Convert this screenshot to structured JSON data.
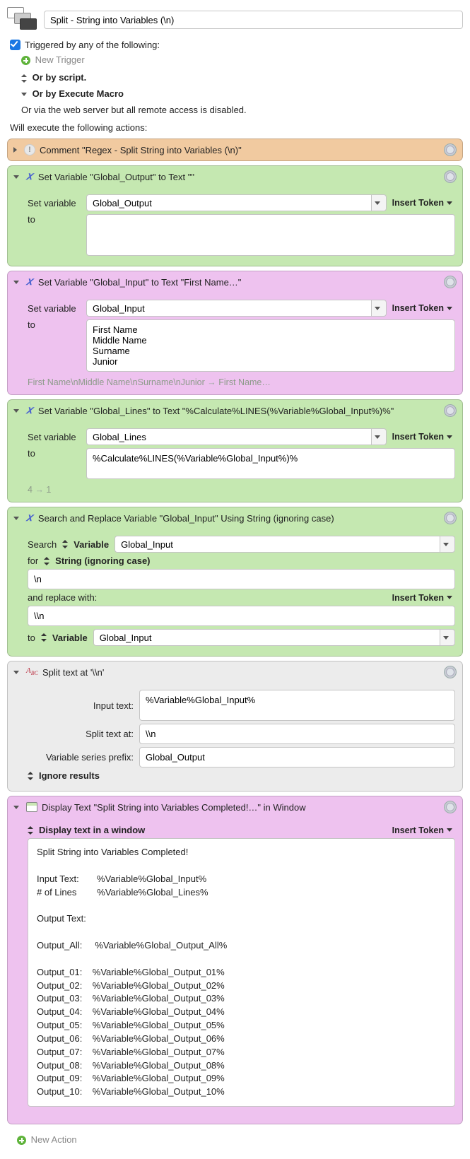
{
  "header": {
    "title": "Split - String into Variables (\\n)"
  },
  "trigger": {
    "checkbox_label": "Triggered by any of the following:",
    "new_trigger": "New Trigger",
    "by_script": "Or by script.",
    "by_execute_macro": "Or by Execute Macro",
    "via_web": "Or via the web server but all remote access is disabled."
  },
  "will_execute": "Will execute the following actions:",
  "labels": {
    "set_variable": "Set variable",
    "to": "to",
    "insert_token": "Insert Token",
    "search": "Search",
    "variable": "Variable",
    "for": "for",
    "string_ignore": "String (ignoring case)",
    "and_replace_with": "and replace with:",
    "input_text": "Input text:",
    "split_text_at": "Split text at:",
    "var_prefix": "Variable series prefix:",
    "ignore_results": "Ignore results",
    "display_text_window": "Display text in a window",
    "new_action": "New Action"
  },
  "actions": {
    "comment": {
      "title": "Comment \"Regex - Split String into Variables (\\n)\""
    },
    "set_output": {
      "title": "Set Variable \"Global_Output\" to Text \"\"",
      "var": "Global_Output",
      "value": ""
    },
    "set_input": {
      "title": "Set Variable \"Global_Input\" to Text \"First Name…\"",
      "var": "Global_Input",
      "value": "First Name\nMiddle Name\nSurname\nJunior",
      "hint_src": "First Name\\nMiddle Name\\nSurname\\nJunior",
      "hint_dst": "First Name…"
    },
    "set_lines": {
      "title": "Set Variable \"Global_Lines\" to Text \"%Calculate%LINES(%Variable%Global_Input%)%\"",
      "var": "Global_Lines",
      "value": "%Calculate%LINES(%Variable%Global_Input%)%",
      "hint_src": "4",
      "hint_dst": "1"
    },
    "search_replace": {
      "title": "Search and Replace Variable \"Global_Input\" Using String (ignoring case)",
      "search_var": "Global_Input",
      "for_value": "\\n",
      "replace_value": "\\\\n",
      "to_var": "Global_Input"
    },
    "split": {
      "title": "Split text at '\\\\n'",
      "input_text": "%Variable%Global_Input%",
      "split_at": "\\\\n",
      "prefix": "Global_Output"
    },
    "display": {
      "title": "Display Text \"Split String into Variables Completed!…\" in Window",
      "body": "Split String into Variables Completed!\n\nInput Text:       %Variable%Global_Input%\n# of Lines        %Variable%Global_Lines%\n\nOutput Text:\n\nOutput_All:     %Variable%Global_Output_All%\n\nOutput_01:    %Variable%Global_Output_01%\nOutput_02:    %Variable%Global_Output_02%\nOutput_03:    %Variable%Global_Output_03%\nOutput_04:    %Variable%Global_Output_04%\nOutput_05:    %Variable%Global_Output_05%\nOutput_06:    %Variable%Global_Output_06%\nOutput_07:    %Variable%Global_Output_07%\nOutput_08:    %Variable%Global_Output_08%\nOutput_09:    %Variable%Global_Output_09%\nOutput_10:    %Variable%Global_Output_10%"
    }
  }
}
